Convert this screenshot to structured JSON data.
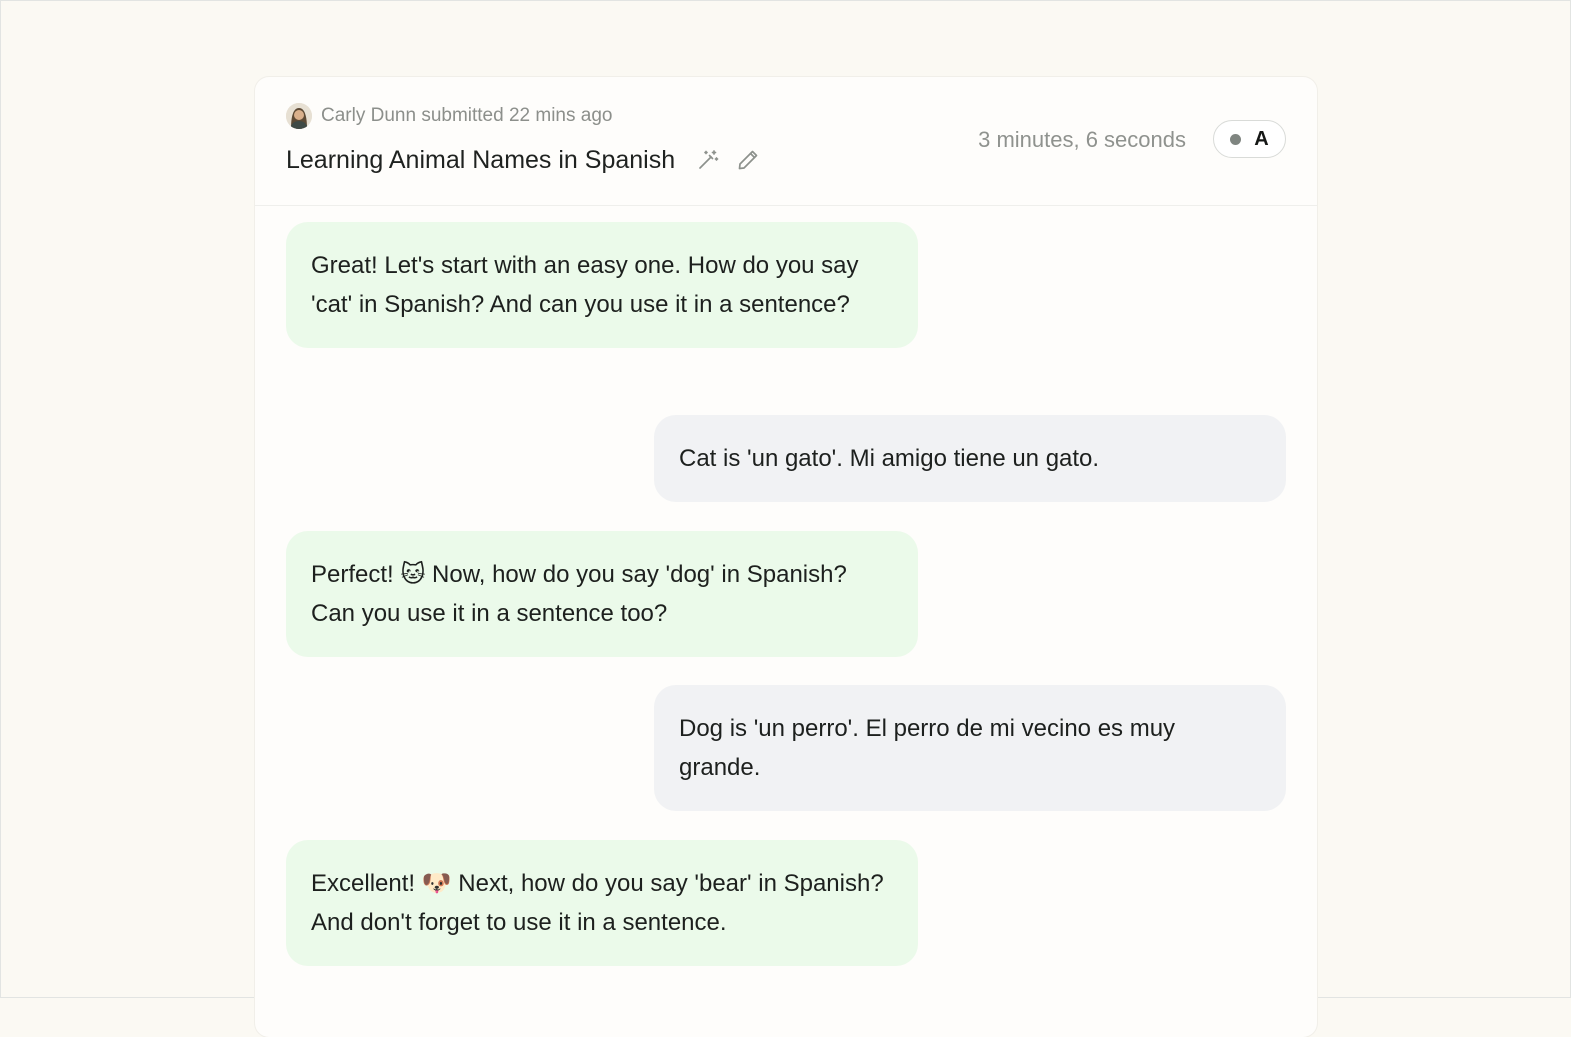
{
  "header": {
    "submitter": "Carly Dunn submitted 22 mins ago",
    "title": "Learning Animal Names in Spanish",
    "duration": "3 minutes, 6 seconds",
    "status_label": "A"
  },
  "icons": {
    "avatar": "user-avatar",
    "magic": "magic-wand-icon",
    "edit": "pencil-icon"
  },
  "messages": [
    {
      "role": "assistant",
      "text": "Great! Let's start with an easy one. How do you say 'cat' in Spanish? And can you use it in a sentence?"
    },
    {
      "role": "user",
      "text": "Cat is 'un gato'. Mi amigo tiene un gato."
    },
    {
      "role": "assistant",
      "text": "Perfect! 🐱 Now, how do you say 'dog' in Spanish? Can you use it in a sentence too?"
    },
    {
      "role": "user",
      "text": "Dog is 'un perro'. El perro de mi vecino es muy grande."
    },
    {
      "role": "assistant",
      "text": "Excellent! 🐶 Next, how do you say 'bear' in Spanish? And don't forget to use it in a sentence."
    }
  ],
  "colors": {
    "assistant_bubble": "#ebfaea",
    "user_bubble": "#f1f2f4",
    "page_background": "#fbf9f3"
  }
}
